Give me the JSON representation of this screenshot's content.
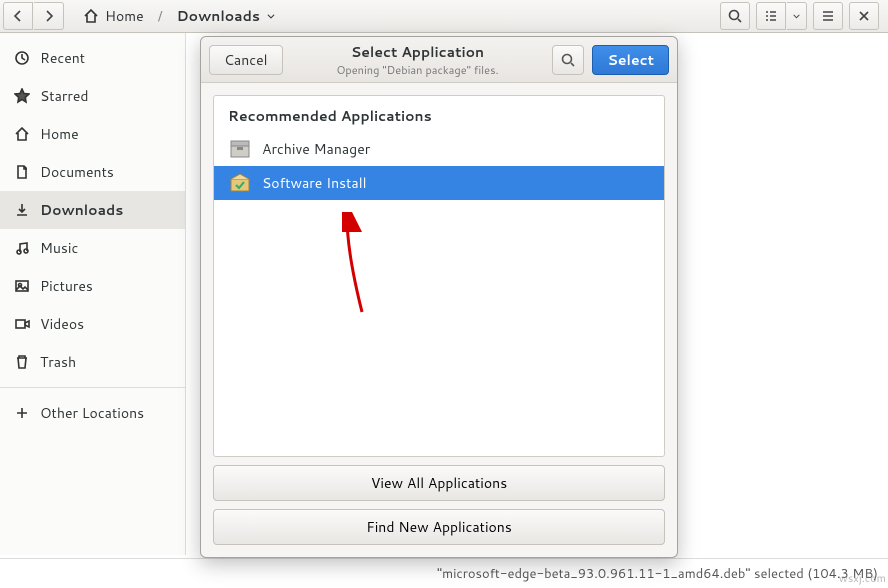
{
  "header": {
    "path": {
      "home": "Home",
      "location": "Downloads"
    }
  },
  "sidebar": {
    "items": [
      {
        "label": "Recent",
        "icon": "clock"
      },
      {
        "label": "Starred",
        "icon": "star"
      },
      {
        "label": "Home",
        "icon": "home"
      },
      {
        "label": "Documents",
        "icon": "document"
      },
      {
        "label": "Downloads",
        "icon": "download",
        "selected": true
      },
      {
        "label": "Music",
        "icon": "music"
      },
      {
        "label": "Pictures",
        "icon": "picture"
      },
      {
        "label": "Videos",
        "icon": "video"
      },
      {
        "label": "Trash",
        "icon": "trash"
      }
    ],
    "other": "Other Locations"
  },
  "dialog": {
    "title": "Select Application",
    "subtitle": "Opening \"Debian package\" files.",
    "cancel": "Cancel",
    "select": "Select",
    "recommended_header": "Recommended Applications",
    "apps": [
      {
        "name": "Archive Manager",
        "selected": false
      },
      {
        "name": "Software Install",
        "selected": true
      }
    ],
    "view_all": "View All Applications",
    "find_new": "Find New Applications"
  },
  "status": {
    "text": "\"microsoft-edge-beta_93.0.961.11-1_amd64.deb\" selected (104.3 MB)"
  },
  "watermark": "wsxj.com",
  "colors": {
    "accent": "#3584e4"
  }
}
